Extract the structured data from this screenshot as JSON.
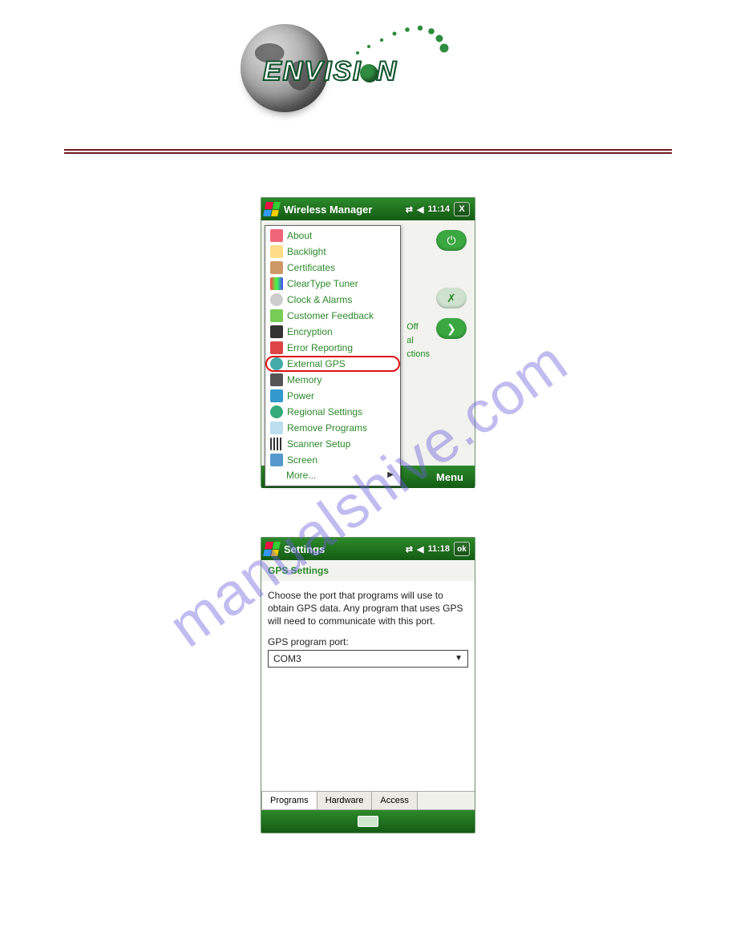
{
  "logo": {
    "text_plain": "ENVISION"
  },
  "divider": {
    "present": true
  },
  "watermark": "manualshive.com",
  "screenshot1": {
    "title": "Wireless Manager",
    "time": "11:14",
    "close_symbol": "X",
    "menu_items": [
      "About",
      "Backlight",
      "Certificates",
      "ClearType Tuner",
      "Clock & Alarms",
      "Customer Feedback",
      "Encryption",
      "Error Reporting",
      "External GPS",
      "Memory",
      "Power",
      "Regional Settings",
      "Remove Programs",
      "Scanner Setup",
      "Screen"
    ],
    "more_label": "More...",
    "selected_item": "External GPS",
    "right_labels": [
      "Off",
      "al",
      "ctions"
    ],
    "pill_icons": [
      "power",
      "key",
      "arrow"
    ],
    "bottom_menu": "Menu"
  },
  "screenshot2": {
    "title": "Settings",
    "time": "11:18",
    "ok_label": "ok",
    "section": "GPS Settings",
    "description": "Choose the port that programs will use to obtain GPS data. Any program that uses GPS will need to communicate with this port.",
    "port_label": "GPS program port:",
    "port_value": "COM3",
    "tabs": [
      "Programs",
      "Hardware",
      "Access"
    ]
  }
}
